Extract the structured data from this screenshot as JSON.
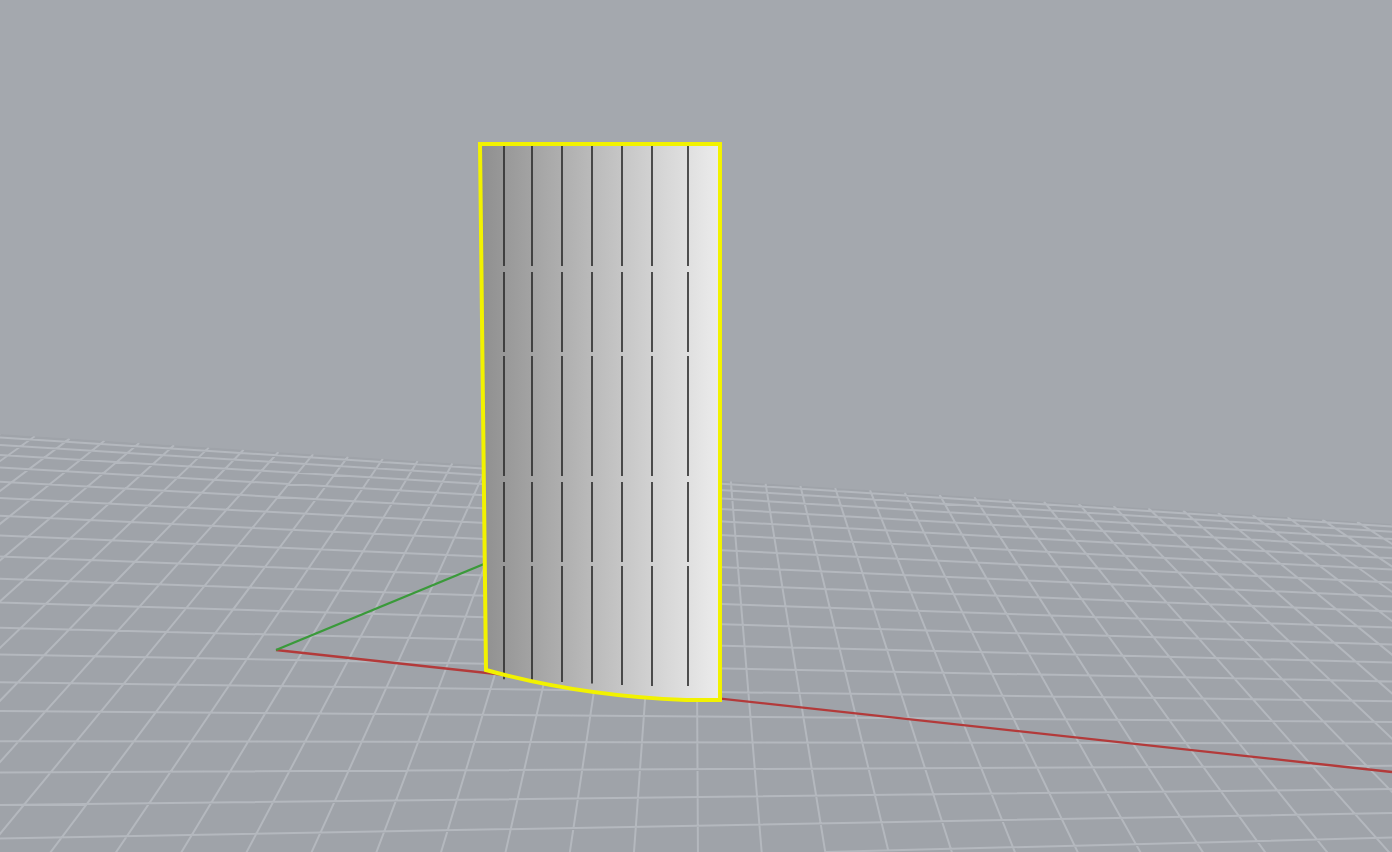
{
  "viewport": {
    "object": {
      "selected": true
    }
  }
}
